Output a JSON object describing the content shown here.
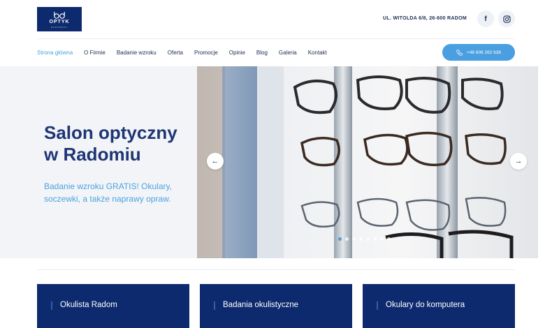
{
  "logo": {
    "text": "OPTYK",
    "sub": "RADOMSKI"
  },
  "header": {
    "address": "UL. WITOLDA 6/8, 26-600 RADOM",
    "facebook_icon": "facebook-icon",
    "instagram_icon": "instagram-icon"
  },
  "nav": {
    "items": [
      "Strona główna",
      "O Firmie",
      "Badanie wzroku",
      "Oferta",
      "Promocje",
      "Opinie",
      "Blog",
      "Galeria",
      "Kontakt"
    ],
    "active_index": 0,
    "phone": "+48 606 262 636"
  },
  "hero": {
    "title": "Salon optyczny\nw Radomiu",
    "subtitle": "Badanie wzroku GRATIS! Okulary, soczewki, a także naprawy opraw.",
    "slides_total": 8,
    "slide_active": 1
  },
  "cards": [
    "Okulista Radom",
    "Badania okulistyczne",
    "Okulary do komputera"
  ],
  "colors": {
    "navy": "#0e2a6e",
    "accent": "#4a9fe0",
    "title": "#1e3675"
  }
}
